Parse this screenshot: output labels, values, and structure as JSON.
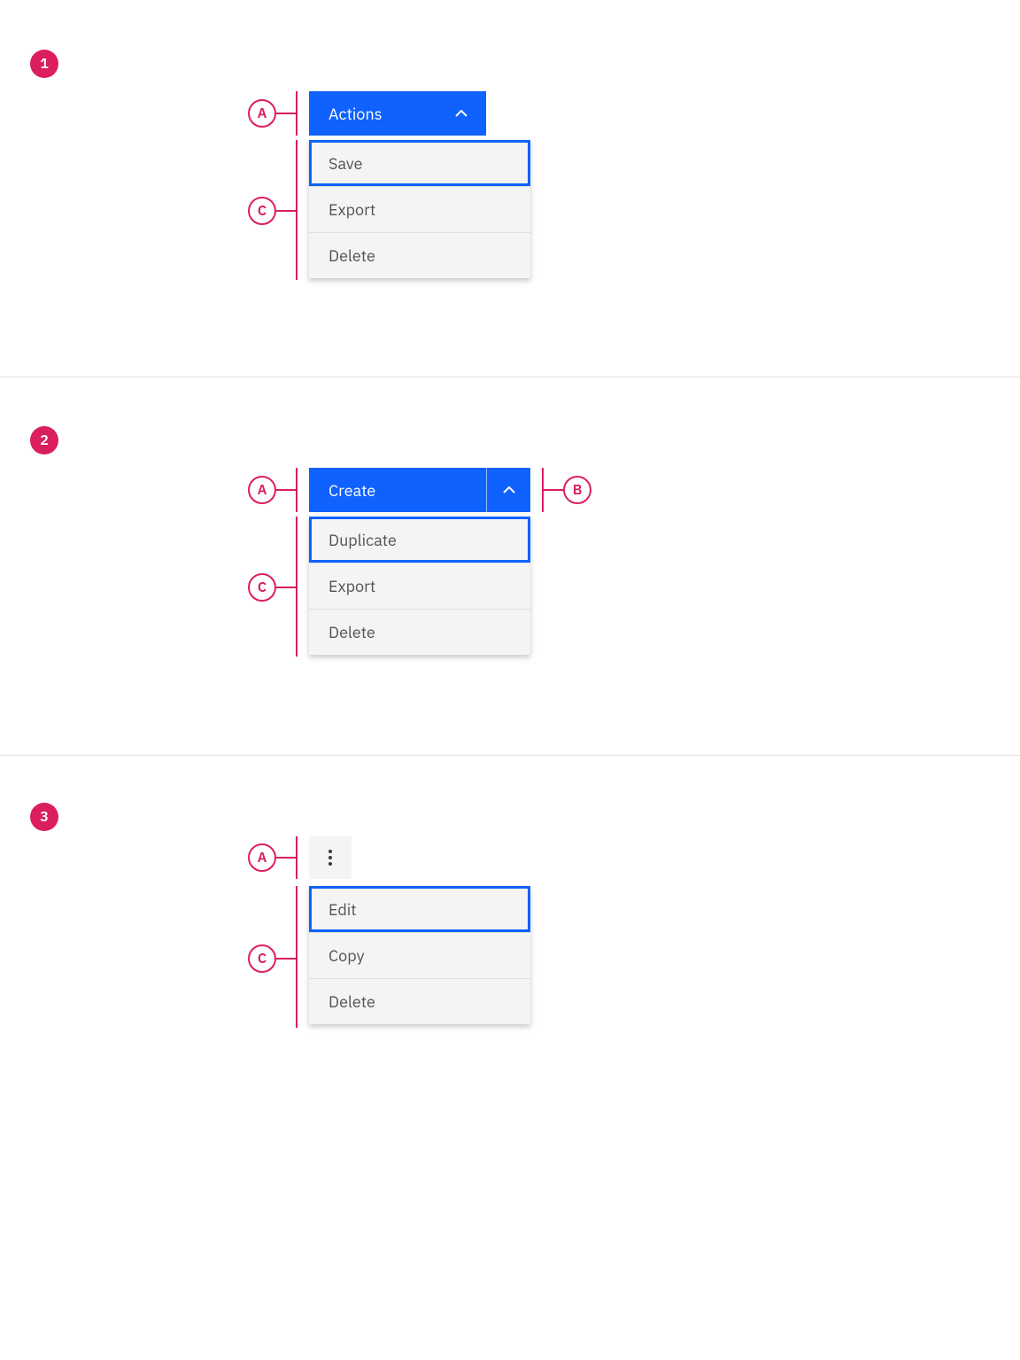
{
  "annotations": {
    "letters": {
      "a": "A",
      "b": "B",
      "c": "C"
    },
    "numbers": {
      "one": "1",
      "two": "2",
      "three": "3"
    }
  },
  "example1": {
    "button_label": "Actions",
    "menu": [
      "Save",
      "Export",
      "Delete"
    ]
  },
  "example2": {
    "button_label": "Create",
    "menu": [
      "Duplicate",
      "Export",
      "Delete"
    ]
  },
  "example3": {
    "menu": [
      "Edit",
      "Copy",
      "Delete"
    ]
  }
}
